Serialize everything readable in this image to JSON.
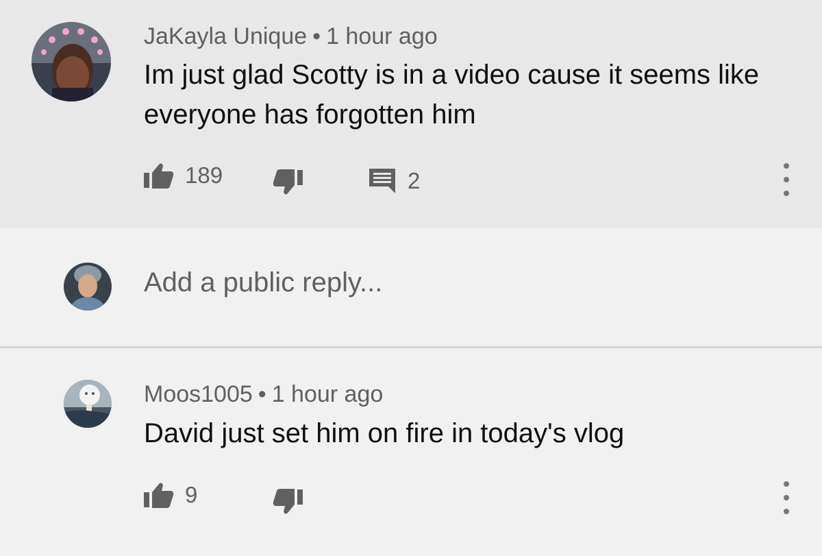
{
  "comments": [
    {
      "author": "JaKayla Unique",
      "separator": "•",
      "time": "1 hour ago",
      "text_line1": "Im just glad Scotty is in a video cause it seems like",
      "text_line2": "everyone has forgotten him",
      "likes": "189",
      "replies": "2",
      "icons": {
        "like": "thumbs-up-icon",
        "dislike": "thumbs-down-icon",
        "reply": "comment-icon",
        "more": "more-vertical-icon"
      }
    },
    {
      "author": "Moos1005",
      "separator": "•",
      "time": "1 hour ago",
      "text": "David just set him on fire in today's vlog",
      "likes": "9",
      "icons": {
        "like": "thumbs-up-icon",
        "dislike": "thumbs-down-icon",
        "more": "more-vertical-icon"
      }
    }
  ],
  "reply_box": {
    "placeholder": "Add a public reply..."
  },
  "colors": {
    "comment_bg": "#e8e8e8",
    "page_bg": "#f1f1f1",
    "meta_text": "#606060",
    "body_text": "#0f0f0f",
    "icon": "#606060"
  }
}
